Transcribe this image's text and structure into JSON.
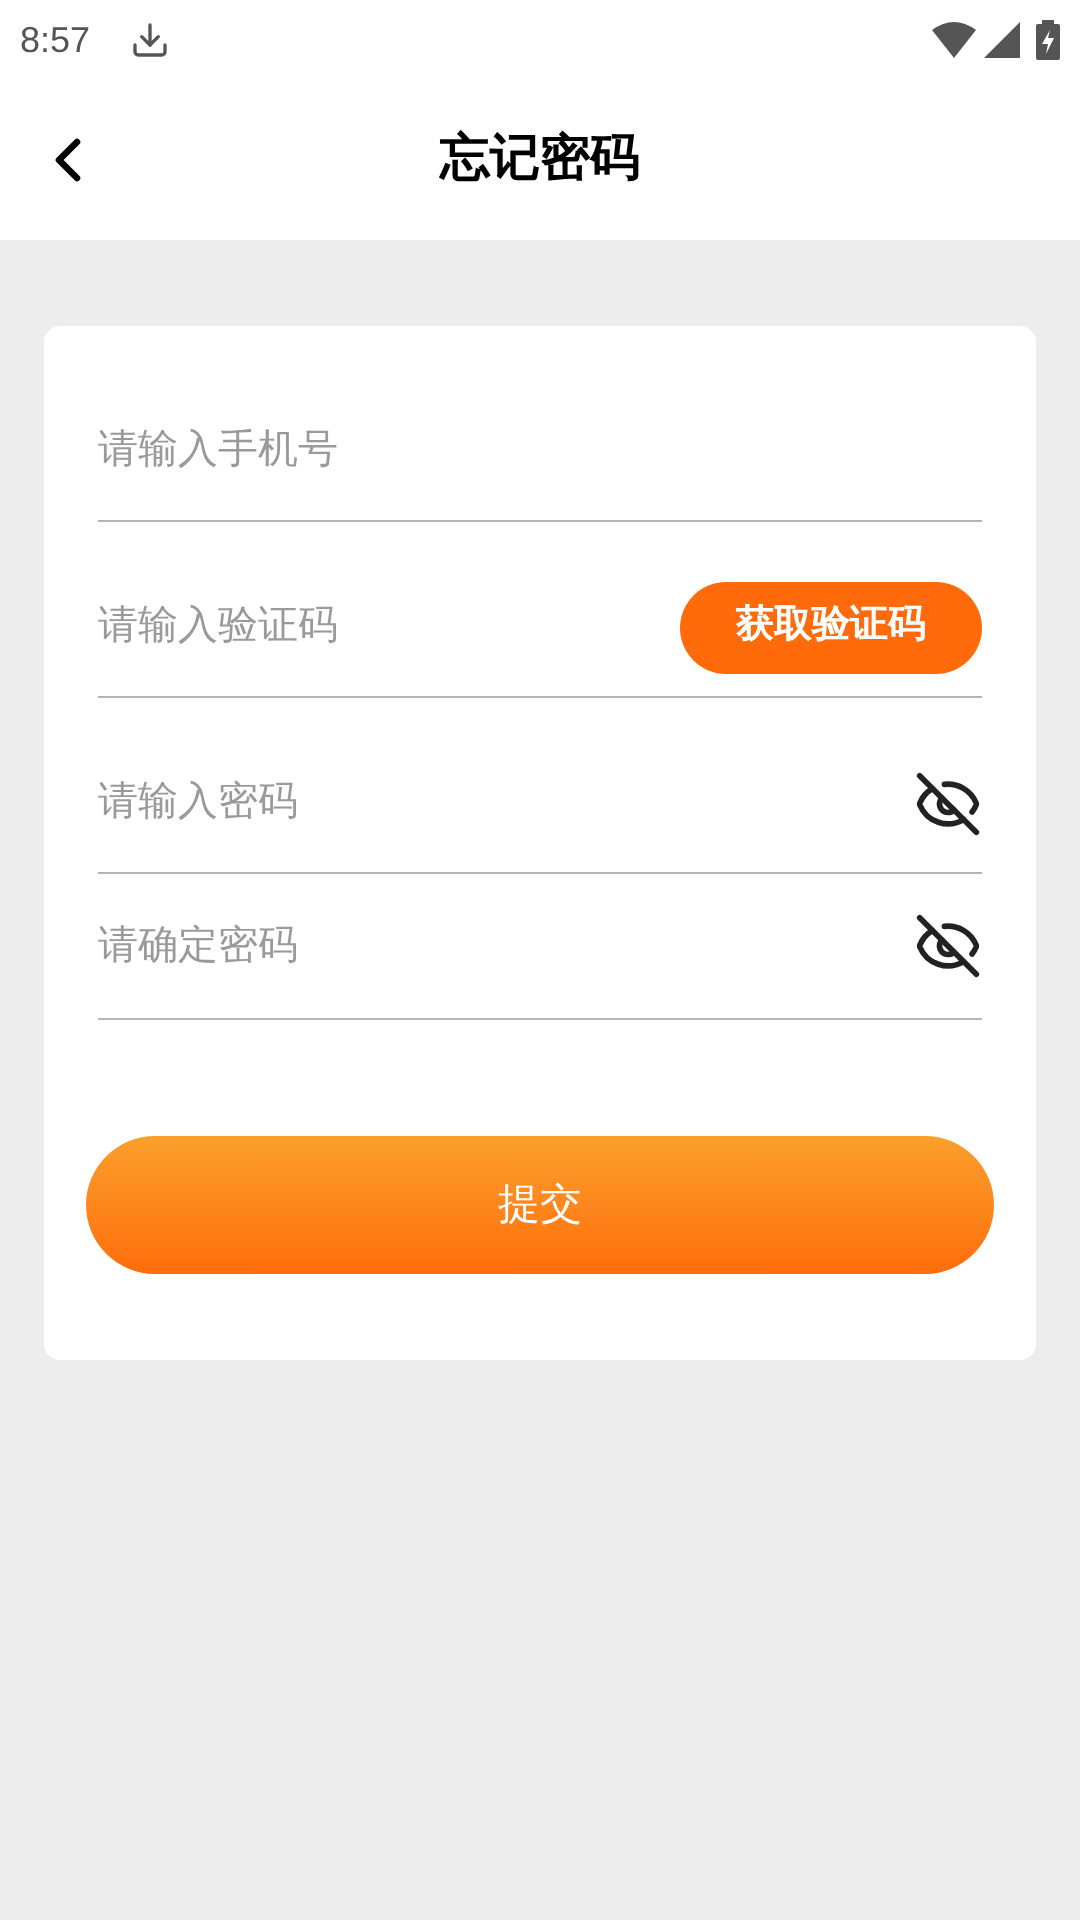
{
  "status_bar": {
    "time": "8:57"
  },
  "header": {
    "title": "忘记密码"
  },
  "fields": [
    {
      "kind": "text",
      "placeholder": "请输入手机号"
    },
    {
      "kind": "code",
      "placeholder": "请输入验证码",
      "button": "获取验证码"
    },
    {
      "kind": "password",
      "placeholder": "请输入密码"
    },
    {
      "kind": "password",
      "placeholder": "请确定密码"
    }
  ],
  "submit": {
    "label": "提交"
  }
}
